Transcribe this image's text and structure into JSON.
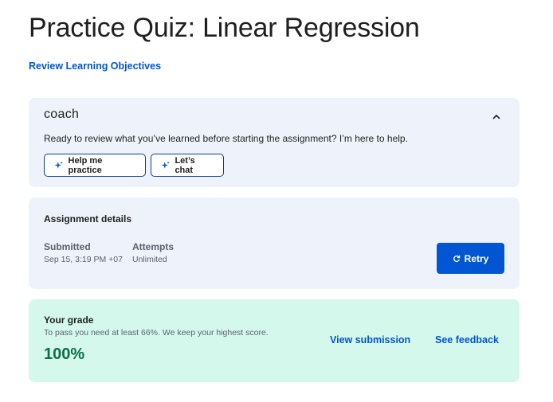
{
  "page": {
    "title": "Practice Quiz: Linear Regression",
    "objectives_link": "Review Learning Objectives"
  },
  "coach": {
    "logo": "coach",
    "chevron_icon": "chevron-up-icon",
    "message": "Ready to review what you’ve learned before starting the assignment? I’m here to help.",
    "buttons": [
      {
        "label": "Help me practice",
        "icon": "sparkle-icon"
      },
      {
        "label": "Let’s chat",
        "icon": "sparkle-icon"
      }
    ]
  },
  "details": {
    "heading": "Assignment details",
    "submitted_label": "Submitted",
    "submitted_value": "Sep 15, 3:19 PM +07",
    "attempts_label": "Attempts",
    "attempts_value": "Unlimited",
    "retry_label": "Retry",
    "retry_icon": "refresh-icon"
  },
  "grade": {
    "heading": "Your grade",
    "note": "To pass you need at least 66%. We keep your highest score.",
    "value": "100%",
    "view_submission": "View submission",
    "see_feedback": "See feedback"
  },
  "colors": {
    "accent": "#0056d2",
    "coach_bg": "#eef3fb",
    "grade_bg": "#d5f8ec",
    "grade_value": "#0b6e47"
  }
}
